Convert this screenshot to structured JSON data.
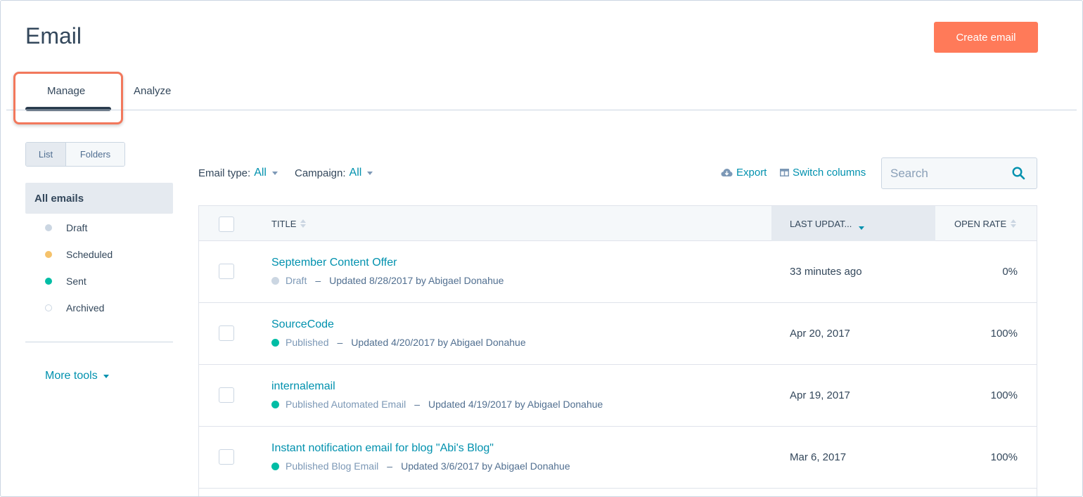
{
  "header": {
    "title": "Email",
    "create_button": "Create email"
  },
  "tabs": [
    {
      "label": "Manage",
      "active": true
    },
    {
      "label": "Analyze",
      "active": false
    }
  ],
  "view_toggle": {
    "list": "List",
    "folders": "Folders",
    "selected": "List"
  },
  "sidebar": {
    "all_emails": "All emails",
    "statuses": [
      {
        "label": "Draft",
        "color": "#cbd6e2"
      },
      {
        "label": "Scheduled",
        "color": "#f5c26b"
      },
      {
        "label": "Sent",
        "color": "#00bda5"
      },
      {
        "label": "Archived",
        "color": "#ffffff"
      }
    ],
    "more_tools": "More tools"
  },
  "filters": {
    "email_type_label": "Email type:",
    "email_type_value": "All",
    "campaign_label": "Campaign:",
    "campaign_value": "All"
  },
  "actions": {
    "export": "Export",
    "switch_columns": "Switch columns"
  },
  "search": {
    "placeholder": "Search"
  },
  "table": {
    "columns": {
      "title": "TITLE",
      "last_updated": "LAST UPDAT...",
      "open_rate": "OPEN RATE"
    },
    "rows": [
      {
        "name": "September Content Offer",
        "status": "Draft",
        "status_color": "#cbd6e2",
        "updated": "Updated 8/28/2017 by Abigael Donahue",
        "date": "33 minutes ago",
        "open_rate": "0%"
      },
      {
        "name": "SourceCode",
        "status": "Published",
        "status_color": "#00bda5",
        "updated": "Updated 4/20/2017 by Abigael Donahue",
        "date": "Apr 20, 2017",
        "open_rate": "100%"
      },
      {
        "name": "internalemail",
        "status": "Published Automated Email",
        "status_color": "#00bda5",
        "updated": "Updated 4/19/2017 by Abigael Donahue",
        "date": "Apr 19, 2017",
        "open_rate": "100%"
      },
      {
        "name": "Instant notification email for blog \"Abi's Blog\"",
        "status": "Published Blog Email",
        "status_color": "#00bda5",
        "updated": "Updated 3/6/2017 by Abigael Donahue",
        "date": "Mar 6, 2017",
        "open_rate": "100%"
      }
    ]
  },
  "colors": {
    "accent": "#0091ae",
    "primary_button": "#ff7a59",
    "highlight_border": "#f2785c"
  }
}
